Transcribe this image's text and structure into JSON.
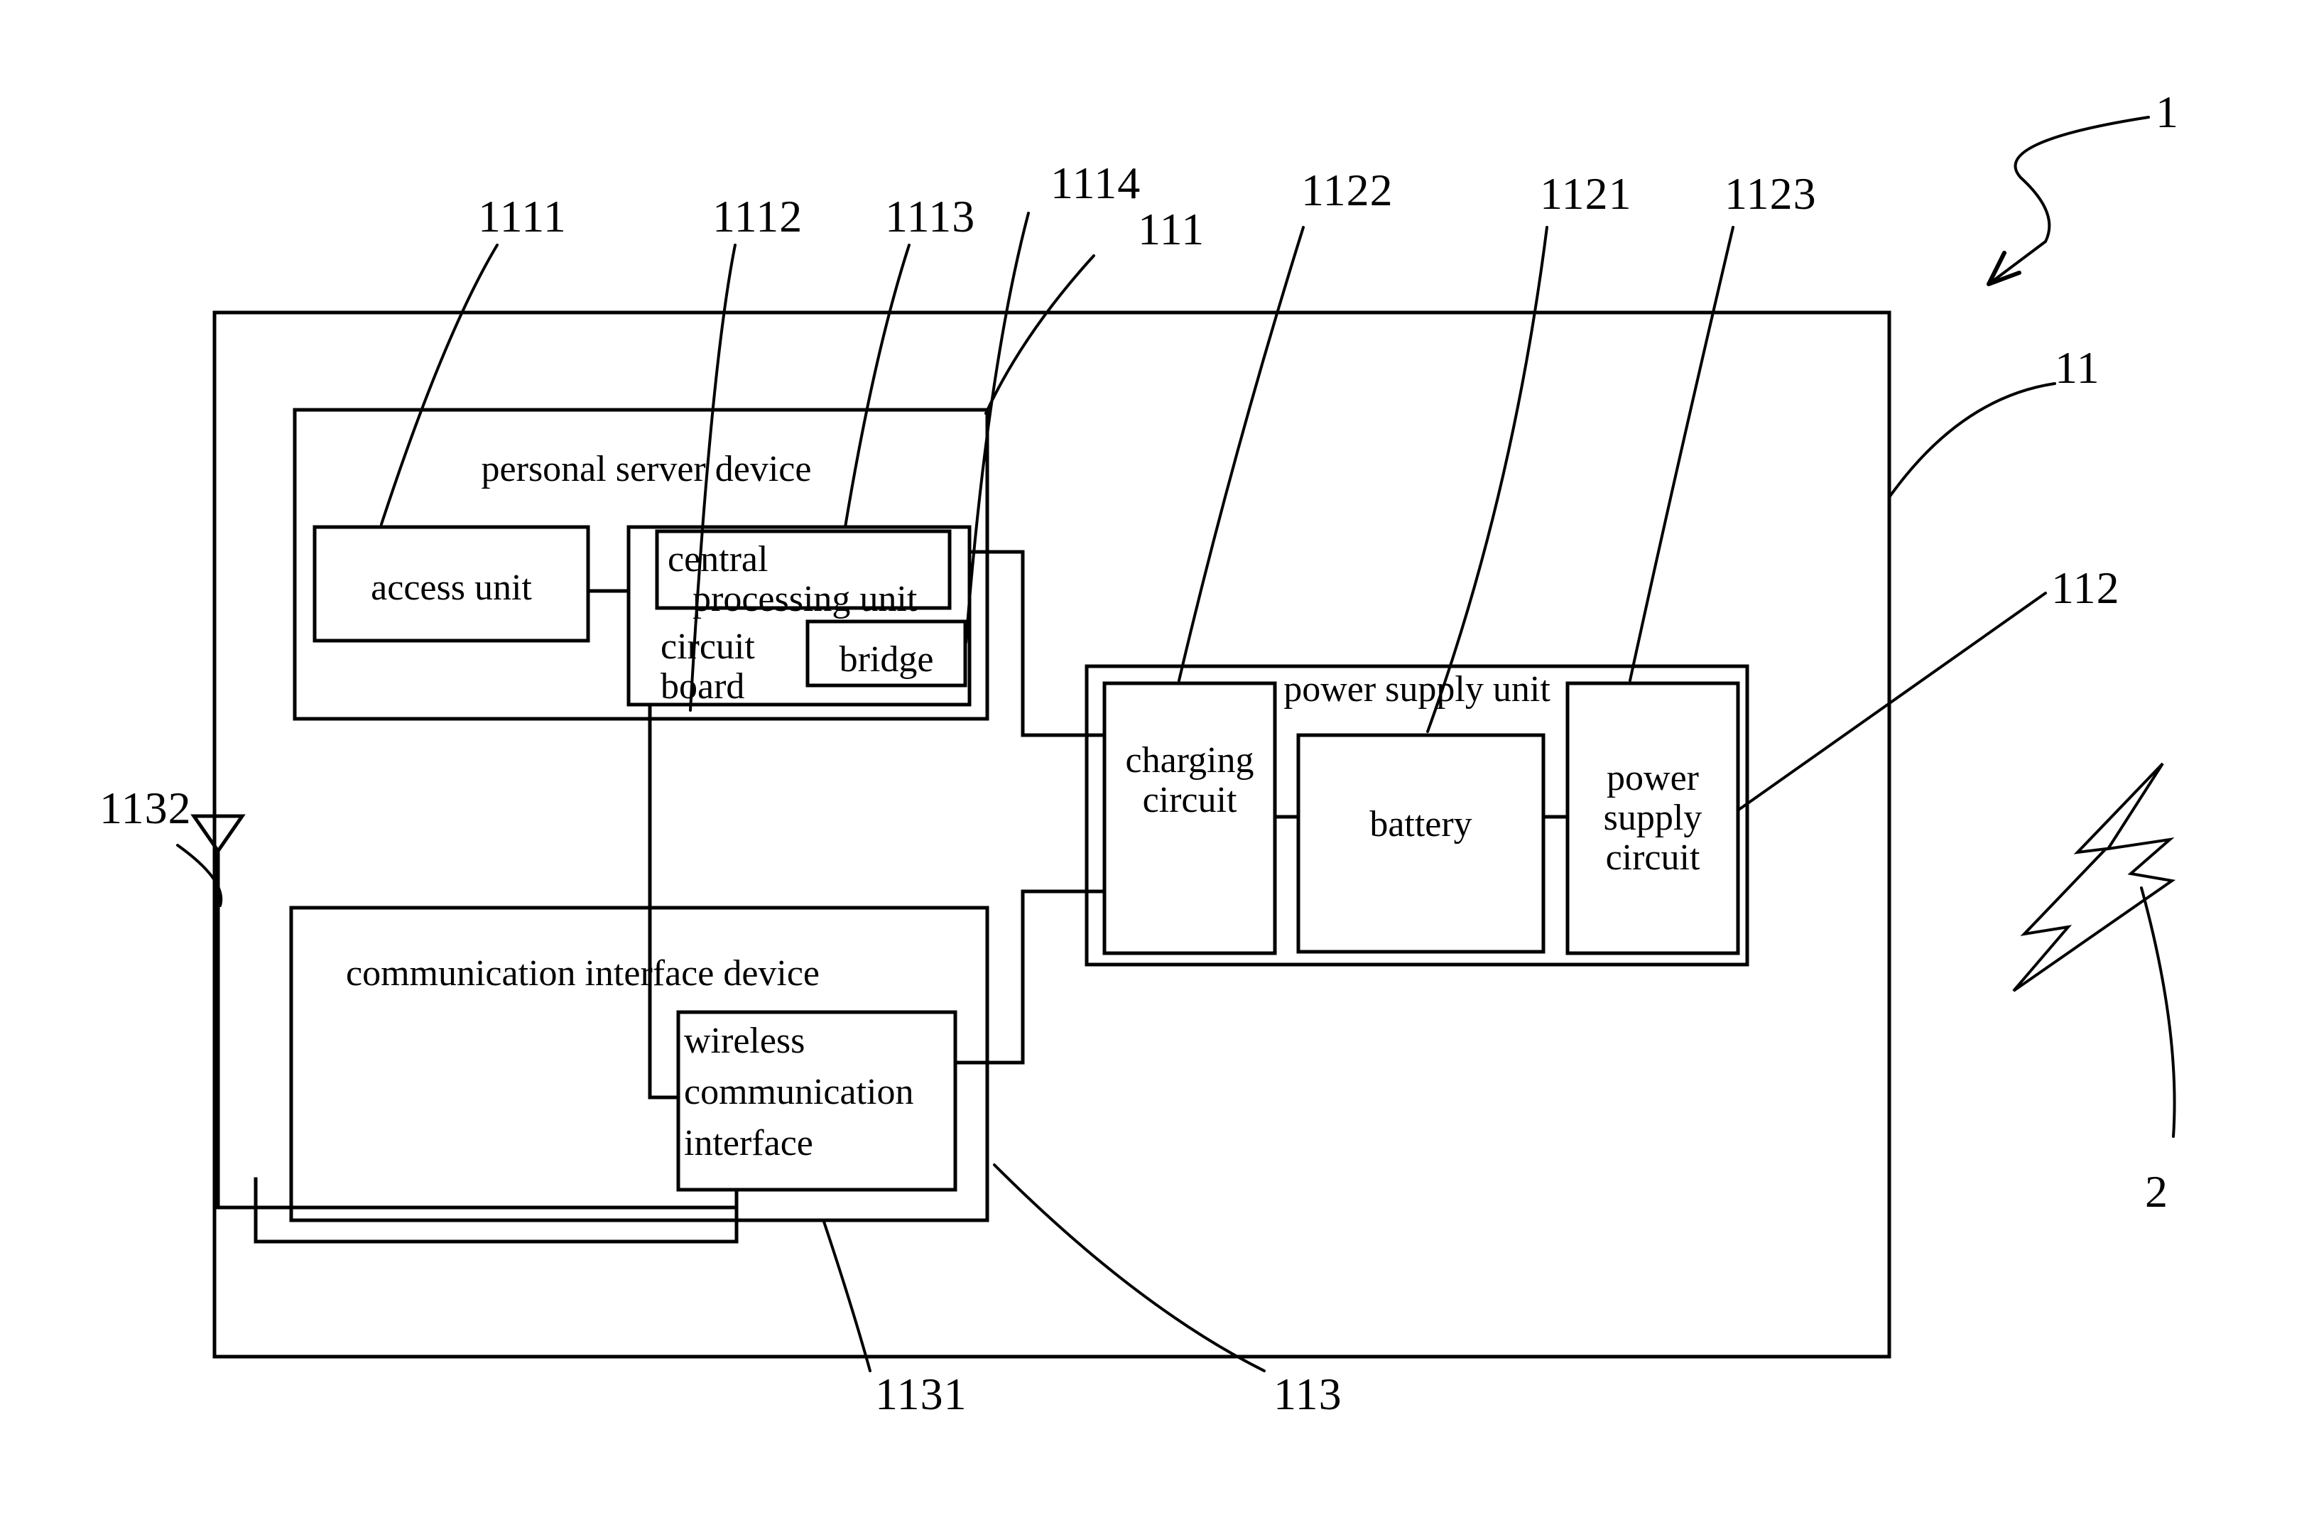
{
  "figure": {
    "type": "patent-block-diagram",
    "outer_device": {
      "reference": "11",
      "description": "outer apparatus frame"
    },
    "overall_reference": "1",
    "external_signal": {
      "reference": "2",
      "icon": "lightning-bolt-icon"
    }
  },
  "blocks": {
    "personal_server_device": {
      "label": "personal server device",
      "reference": "111"
    },
    "access_unit": {
      "label": "access unit",
      "reference": "1111"
    },
    "circuit_board": {
      "label": "circuit\nboard",
      "label_line1": "circuit",
      "label_line2": "board",
      "reference": "1112"
    },
    "central_processing_unit": {
      "label": "central\nprocessing unit",
      "label_line1": "central",
      "label_line2": "processing unit",
      "reference": "1113"
    },
    "bridge": {
      "label": "bridge",
      "reference": "1114"
    },
    "power_supply_unit": {
      "label": "power supply unit",
      "reference": "112"
    },
    "charging_circuit": {
      "label": "charging\ncircuit",
      "label_line1": "charging",
      "label_line2": "circuit",
      "reference": "1122"
    },
    "battery": {
      "label": "battery",
      "reference": "1121"
    },
    "power_supply_circuit": {
      "label": "power\nsupply\ncircuit",
      "label_line1": "power",
      "label_line2": "supply",
      "label_line3": "circuit",
      "reference": "1123"
    },
    "communication_interface_device": {
      "label": "communication interface device",
      "reference": "113"
    },
    "wireless_communication_interface": {
      "label": "wireless\ncommunication\ninterface",
      "label_line1": "wireless",
      "label_line2": "communication",
      "label_line3": "interface",
      "reference": "1131"
    },
    "antenna": {
      "label": "",
      "reference": "1132",
      "icon": "antenna-icon"
    }
  },
  "reference_numerals": [
    {
      "value": "1111",
      "target": "access unit"
    },
    {
      "value": "1112",
      "target": "circuit board"
    },
    {
      "value": "1113",
      "target": "central processing unit"
    },
    {
      "value": "1114",
      "target": "bridge"
    },
    {
      "value": "111",
      "target": "personal server device"
    },
    {
      "value": "1122",
      "target": "charging circuit"
    },
    {
      "value": "1121",
      "target": "battery"
    },
    {
      "value": "1123",
      "target": "power supply circuit"
    },
    {
      "value": "112",
      "target": "power supply unit"
    },
    {
      "value": "11",
      "target": "outer device frame"
    },
    {
      "value": "1",
      "target": "overall system"
    },
    {
      "value": "2",
      "target": "lightning bolt / external signal"
    },
    {
      "value": "1132",
      "target": "antenna"
    },
    {
      "value": "1131",
      "target": "wireless communication interface"
    },
    {
      "value": "113",
      "target": "communication interface device"
    }
  ],
  "style": {
    "line_color": "#000000",
    "background": "#ffffff"
  }
}
